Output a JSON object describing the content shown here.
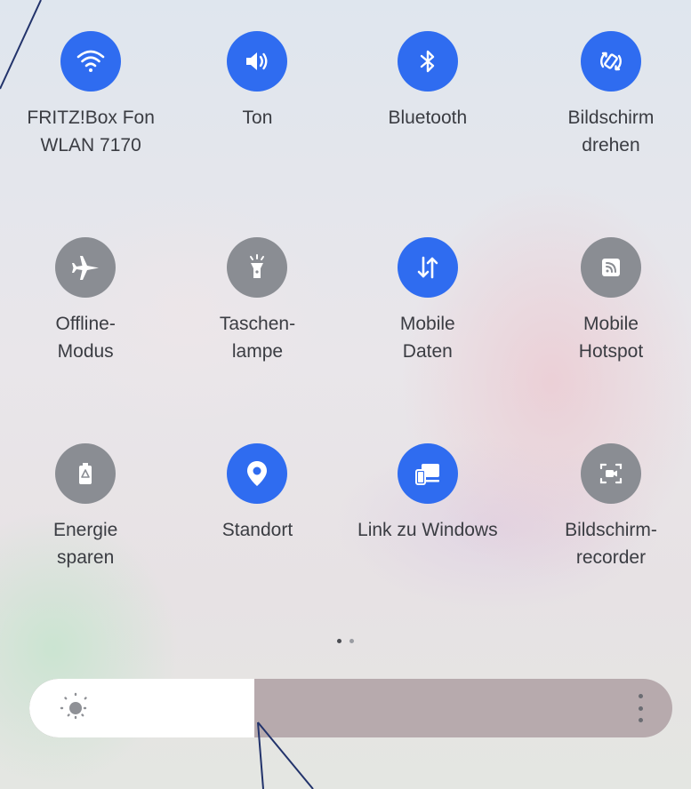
{
  "quick_settings": {
    "tiles": [
      {
        "id": "wifi",
        "label_line1": "FRITZ!Box Fon",
        "label_line2": "WLAN 7170",
        "state": "on",
        "icon": "wifi-icon"
      },
      {
        "id": "sound",
        "label_line1": "Ton",
        "label_line2": "",
        "state": "on",
        "icon": "speaker-icon"
      },
      {
        "id": "bluetooth",
        "label_line1": "Bluetooth",
        "label_line2": "",
        "state": "on",
        "icon": "bluetooth-icon"
      },
      {
        "id": "autorotate",
        "label_line1": "Bildschirm",
        "label_line2": "drehen",
        "state": "on",
        "icon": "rotate-icon"
      },
      {
        "id": "airplane",
        "label_line1": "Offline-",
        "label_line2": "Modus",
        "state": "off",
        "icon": "airplane-icon"
      },
      {
        "id": "flashlight",
        "label_line1": "Taschen-",
        "label_line2": "lampe",
        "state": "off",
        "icon": "flashlight-icon"
      },
      {
        "id": "mobile-data",
        "label_line1": "Mobile",
        "label_line2": "Daten",
        "state": "on",
        "icon": "data-arrows-icon"
      },
      {
        "id": "hotspot",
        "label_line1": "Mobile",
        "label_line2": "Hotspot",
        "state": "off",
        "icon": "hotspot-icon"
      },
      {
        "id": "power-saving",
        "label_line1": "Energie",
        "label_line2": "sparen",
        "state": "off",
        "icon": "battery-icon"
      },
      {
        "id": "location",
        "label_line1": "Standort",
        "label_line2": "",
        "state": "on",
        "icon": "location-pin-icon"
      },
      {
        "id": "link-to-windows",
        "label_line1": "Link zu Windows",
        "label_line2": "",
        "state": "on",
        "icon": "link-windows-icon"
      },
      {
        "id": "screen-recorder",
        "label_line1": "Bildschirm-",
        "label_line2": "recorder",
        "state": "off",
        "icon": "screen-recorder-icon"
      }
    ],
    "page_indicator": {
      "pages": 2,
      "current": 1
    }
  },
  "brightness": {
    "level": 0.35,
    "icon": "sun-icon",
    "menu_icon": "more-vertical-icon"
  },
  "colors": {
    "tile_on": "#2f6cf0",
    "tile_off": "#8a8d93",
    "annotation": "#22336b"
  }
}
